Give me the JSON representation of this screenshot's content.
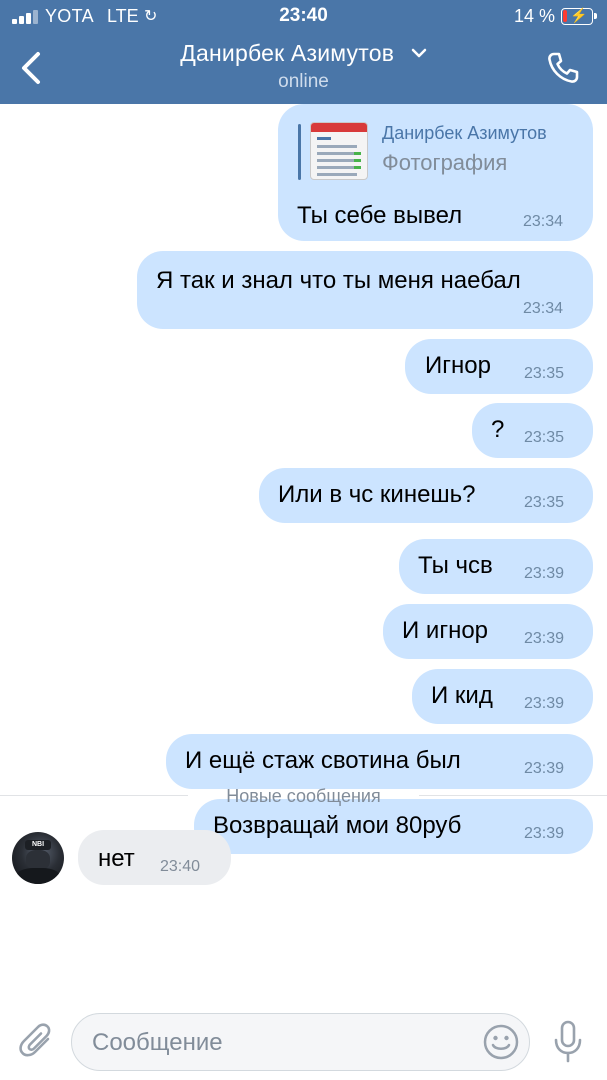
{
  "status_bar": {
    "carrier": "YOTA",
    "network": "LTE",
    "time": "23:40",
    "battery": "14 %",
    "battery_level": 0.14,
    "battery_color": "#ff3b30"
  },
  "header": {
    "title": "Данирбек Азимутов",
    "subtitle": "online",
    "background": "#4a76a8",
    "back_icon": "chevron-left-icon",
    "title_icon": "chevron-down-icon",
    "call_icon": "phone-icon"
  },
  "messages": [
    {
      "reply": {
        "name": "Данирбек Азимутов",
        "text": "Фотография",
        "thumbnail_icon": "photo-thumbnail"
      },
      "text": "Ты себе вывел",
      "time": "23:34"
    },
    {
      "text": "Я так и знал что ты меня наебал",
      "time": "23:34"
    },
    {
      "text": "Игнор",
      "time": "23:35"
    },
    {
      "text": "?",
      "time": "23:35"
    },
    {
      "text": "Или в чс кинешь?",
      "time": "23:35"
    },
    {
      "text": "Ты чсв",
      "time": "23:39"
    },
    {
      "text": "И игнор",
      "time": "23:39"
    },
    {
      "text": "И кид",
      "time": "23:39"
    },
    {
      "text": "И ещё стаж свотина был",
      "time": "23:39"
    },
    {
      "text": "Возвращай мои 80руб",
      "time": "23:39"
    }
  ],
  "new_messages_divider": "Новые сообщения",
  "incoming": {
    "text": "нет",
    "time": "23:40",
    "avatar_text": "NBI"
  },
  "colors": {
    "outgoing_bubble": "#cce4ff",
    "incoming_bubble": "#ebedf0",
    "accent": "#4a76a8"
  },
  "composer": {
    "placeholder": "Сообщение",
    "attach_icon": "paperclip-icon",
    "emoji_icon": "smile-icon",
    "mic_icon": "microphone-icon"
  }
}
